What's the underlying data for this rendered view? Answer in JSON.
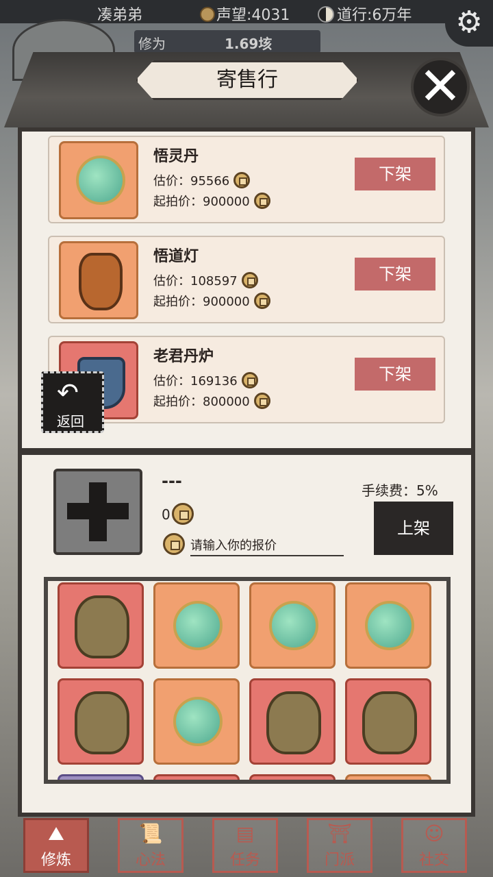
{
  "status_bar": {
    "player_name": "凑弟弟",
    "fame": "声望:4031",
    "dao": "道行:6万年"
  },
  "cultivation": {
    "label": "修为",
    "value": "1.69垓"
  },
  "window": {
    "title": "寄售行"
  },
  "listings": [
    {
      "name": "悟灵丹",
      "estimate": "估价：95566",
      "start": "起拍价：900000",
      "action": "下架",
      "icon": "orb-pill-icon"
    },
    {
      "name": "悟道灯",
      "estimate": "估价：108597",
      "start": "起拍价：900000",
      "action": "下架",
      "icon": "lantern-icon"
    },
    {
      "name": "老君丹炉",
      "estimate": "估价：169136",
      "start": "起拍价：800000",
      "action": "下架",
      "icon": "furnace-icon"
    }
  ],
  "back_button": {
    "label": "返回"
  },
  "sell": {
    "selected_name": "---",
    "selected_price": "0",
    "bid_placeholder": "请输入你的报价",
    "fee": "手续费：5%",
    "list_label": "上架"
  },
  "inventory": [
    {
      "kind": "talisman-icon",
      "color": "red"
    },
    {
      "kind": "orb-pill-icon",
      "color": "orange"
    },
    {
      "kind": "orb-pill-icon",
      "color": "orange"
    },
    {
      "kind": "orb-pill-icon",
      "color": "orange"
    },
    {
      "kind": "talisman-icon",
      "color": "red"
    },
    {
      "kind": "orb-pill-icon",
      "color": "orange"
    },
    {
      "kind": "talisman-icon",
      "color": "red"
    },
    {
      "kind": "talisman-icon",
      "color": "red"
    },
    {
      "kind": "",
      "color": "purple"
    },
    {
      "kind": "",
      "color": "red"
    },
    {
      "kind": "",
      "color": "red"
    },
    {
      "kind": "",
      "color": "orange"
    }
  ],
  "bottom_nav": [
    {
      "label": "修炼",
      "active": true
    },
    {
      "label": "心法",
      "active": false
    },
    {
      "label": "任务",
      "active": false
    },
    {
      "label": "门派",
      "active": false
    },
    {
      "label": "社交",
      "active": false
    }
  ]
}
